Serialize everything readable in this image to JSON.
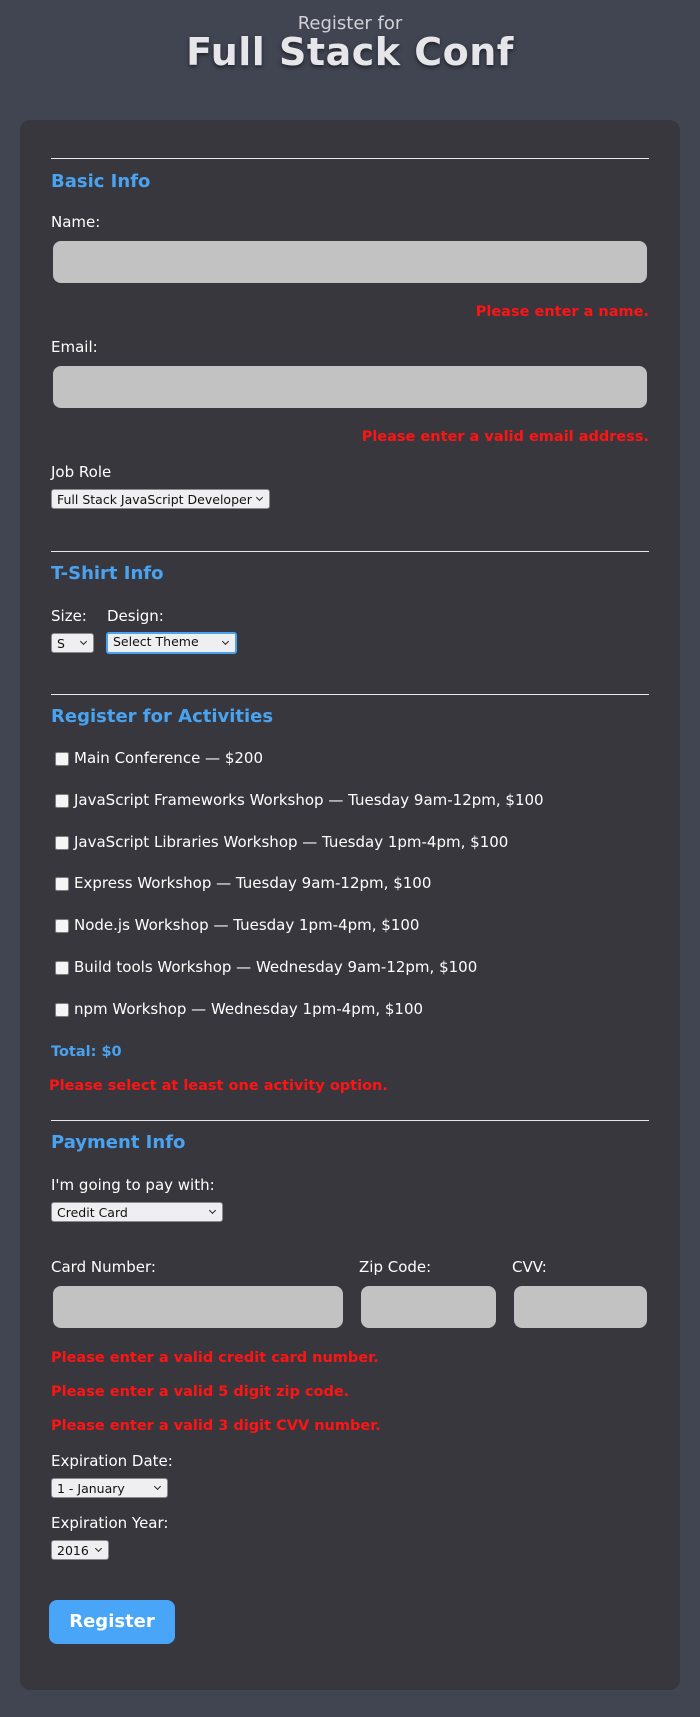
{
  "header": {
    "pretitle": "Register for",
    "title": "Full Stack Conf"
  },
  "basic_info": {
    "title": "Basic Info",
    "name_label": "Name:",
    "name_value": "",
    "name_error": "Please enter a name.",
    "email_label": "Email:",
    "email_value": "",
    "email_error": "Please enter a valid email address.",
    "job_role_label": "Job Role",
    "job_role_value": "Full Stack JavaScript Developer"
  },
  "tshirt_info": {
    "title": "T-Shirt Info",
    "size_label": "Size:",
    "size_value": "S",
    "design_label": "Design:",
    "design_value": "Select Theme"
  },
  "activities": {
    "title": "Register for Activities",
    "items": [
      {
        "label": "Main Conference — $200",
        "checked": false
      },
      {
        "label": "JavaScript Frameworks Workshop — Tuesday 9am-12pm, $100",
        "checked": false
      },
      {
        "label": "JavaScript Libraries Workshop — Tuesday 1pm-4pm, $100",
        "checked": false
      },
      {
        "label": "Express Workshop — Tuesday 9am-12pm, $100",
        "checked": false
      },
      {
        "label": "Node.js Workshop — Tuesday 1pm-4pm, $100",
        "checked": false
      },
      {
        "label": "Build tools Workshop — Wednesday 9am-12pm, $100",
        "checked": false
      },
      {
        "label": "npm Workshop — Wednesday 1pm-4pm, $100",
        "checked": false
      }
    ],
    "total": "Total: $0",
    "error": "Please select at least one activity option."
  },
  "payment_info": {
    "title": "Payment Info",
    "pay_with_label": "I'm going to pay with:",
    "pay_with_value": "Credit Card",
    "card_number_label": "Card Number:",
    "zip_label": "Zip Code:",
    "cvv_label": "CVV:",
    "card_error": "Please enter a valid credit card number.",
    "zip_error": "Please enter a valid 5 digit zip code.",
    "cvv_error": "Please enter a valid 3 digit CVV number.",
    "exp_date_label": "Expiration Date:",
    "exp_date_value": "1 - January",
    "exp_year_label": "Expiration Year:",
    "exp_year_value": "2016"
  },
  "submit_label": "Register",
  "colors": {
    "page_bg": "#414552",
    "card_bg": "#38373e",
    "accent": "#4aa3f0",
    "error": "#ff1414",
    "input_bg": "#c2c2c2",
    "button_bg": "#49a5f7"
  }
}
